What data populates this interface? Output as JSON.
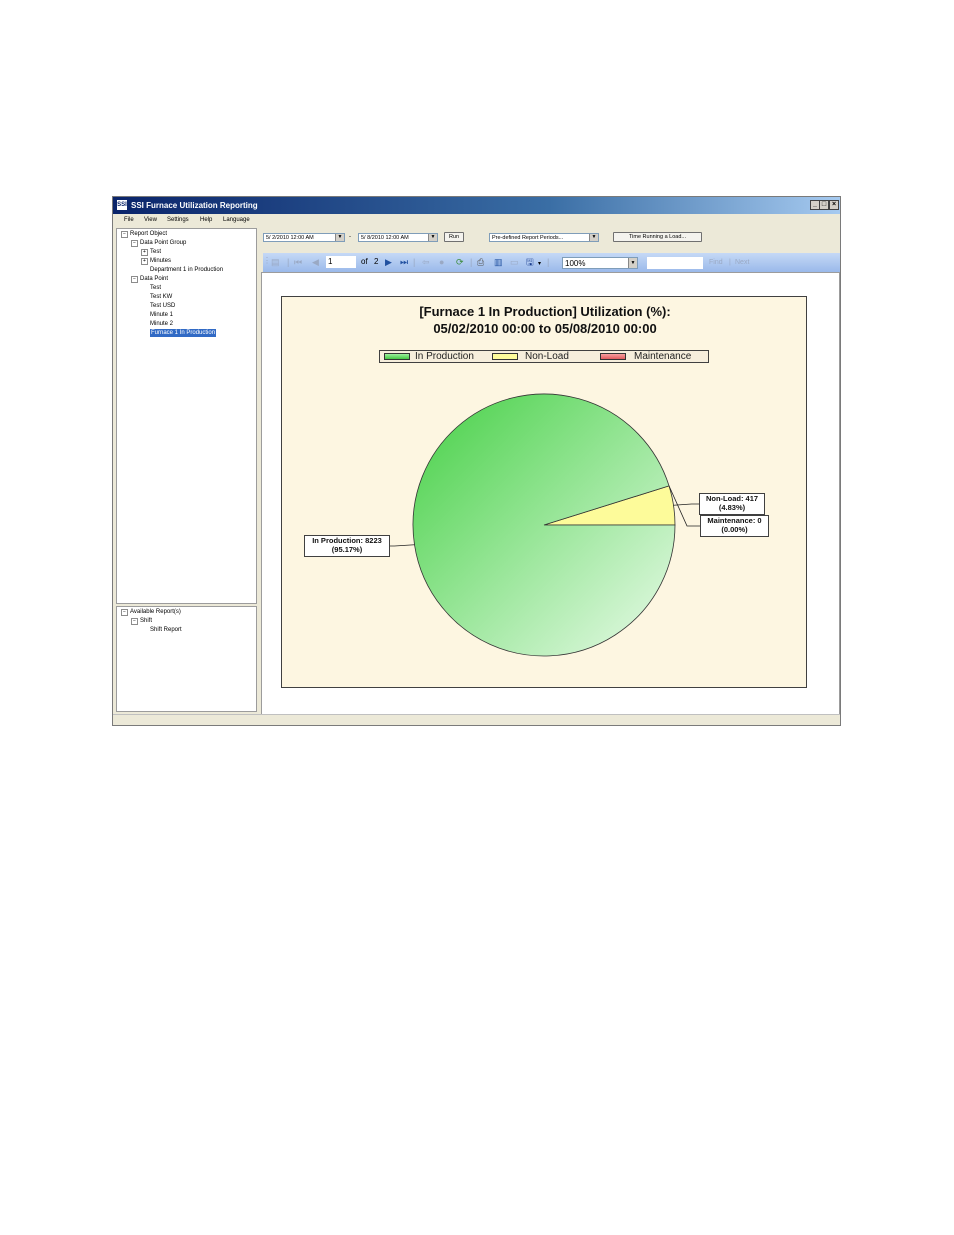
{
  "window": {
    "title": "SSI Furnace Utilization Reporting",
    "icon": "ssi-logo-icon",
    "app_icon_text": "SSI",
    "controls": [
      "minimize-icon",
      "maximize-icon",
      "close-icon"
    ]
  },
  "menu": [
    "File",
    "View",
    "Settings",
    "Help",
    "Language"
  ],
  "report_tree": {
    "root": "Report Object",
    "groups": [
      {
        "label": "Data Point Group",
        "children": [
          "Test",
          "Minutes",
          "Department 1 in Production"
        ]
      },
      {
        "label": "Data Point",
        "children": [
          "Test",
          "Test KW",
          "Test USD",
          "Minute 1",
          "Minute 2",
          "Furnace 1 In Production"
        ]
      }
    ],
    "selected": "Furnace 1 In Production"
  },
  "available_tree": {
    "root": "Available Report(s)",
    "group": "Shift",
    "child": "Shift Report"
  },
  "filters": {
    "start_date": "5/ 2/2010 12:00 AM",
    "separator": "-",
    "end_date": "5/ 8/2010 12:00 AM",
    "run_label": "Run",
    "period_select": "Pre-defined Report Periods...",
    "time_button": "Time Running a Load..."
  },
  "viewer_toolbar": {
    "page": "1",
    "of_label": "of",
    "total_pages": "2",
    "zoom": "100%",
    "find_value": "",
    "find_label": "Find",
    "next_label": "Next",
    "separator": "|"
  },
  "chart_data": {
    "type": "pie",
    "title_line1": "[Furnace 1 In Production] Utilization (%):",
    "title_line2": "05/02/2010 00:00 to 05/08/2010 00:00",
    "legend_position": "top",
    "slices": [
      {
        "name": "In Production",
        "value": 8223,
        "percent": 95.17,
        "color": "#5dd65d",
        "label_line1": "In Production: 8223",
        "label_line2": "(95.17%)"
      },
      {
        "name": "Non-Load",
        "value": 417,
        "percent": 4.83,
        "color": "#fdfb9a",
        "label_line1": "Non-Load: 417",
        "label_line2": "(4.83%)"
      },
      {
        "name": "Maintenance",
        "value": 0,
        "percent": 0.0,
        "color": "#e8666a",
        "label_line1": "Maintenance: 0",
        "label_line2": "(0.00%)"
      }
    ]
  }
}
